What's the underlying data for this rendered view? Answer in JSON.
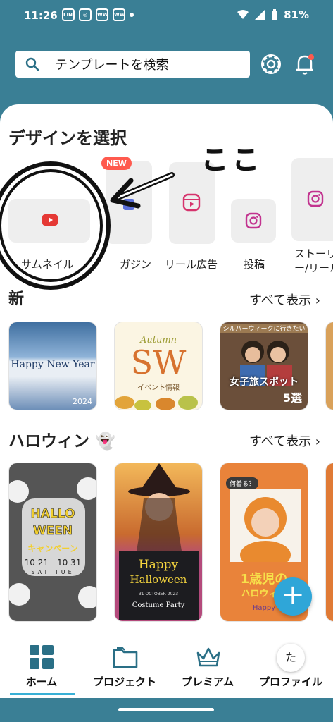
{
  "status_bar": {
    "time": "11:26",
    "battery": "81%",
    "notification_icons": [
      "LINE",
      "instagram",
      "WW",
      "WW"
    ]
  },
  "search": {
    "placeholder": "テンプレートを検索"
  },
  "design_section": {
    "title": "デザインを選択",
    "new_badge": "NEW",
    "items": [
      {
        "label": "サムネイル",
        "icon": "youtube-icon"
      },
      {
        "label": "ガジン",
        "icon": "magazine-icon"
      },
      {
        "label": "リール広告",
        "icon": "reels-icon"
      },
      {
        "label": "投稿",
        "icon": "instagram-icon"
      },
      {
        "label": "ストーリ\nー/リール",
        "icon": "instagram-icon"
      }
    ]
  },
  "annotation": {
    "text": "ここ"
  },
  "new_section": {
    "title": "新",
    "see_all": "すべて表示 ›",
    "thumbs": [
      {
        "title": "Happy New Year",
        "sub": "2024"
      },
      {
        "title": "SW",
        "script": "Autumn",
        "sub": "イベント情報"
      },
      {
        "top": "シルバーウィークに行きたい",
        "title": "女子旅スポット",
        "num": "5選"
      }
    ]
  },
  "halloween_section": {
    "title": "ハロウィン",
    "emoji": "👻",
    "see_all": "すべて表示 ›",
    "thumbs": [
      {
        "line1": "HALLO",
        "line2": "WEEN",
        "line3": "キャンペーン",
        "dates": "10 21 - 10 31",
        "days": "SAT TUE"
      },
      {
        "line1": "Happy",
        "line2": "Halloween",
        "date": "31 OCTOBER 2023",
        "event": "Costume Party"
      },
      {
        "bubble": "何着る？",
        "line1": "1歳児の",
        "line2": "ハロウィン",
        "tag": "Happy"
      }
    ]
  },
  "fab": {
    "label": "+"
  },
  "bottom_nav": [
    {
      "label": "ホーム",
      "icon": "home-grid-icon",
      "active": true
    },
    {
      "label": "プロジェクト",
      "icon": "folder-icon"
    },
    {
      "label": "プレミアム",
      "icon": "crown-icon"
    },
    {
      "label": "プロファイル",
      "icon": "avatar-icon",
      "avatar_text": "た"
    }
  ],
  "colors": {
    "header_bg": "#3a7f95",
    "accent": "#38b0d6",
    "new_badge": "#ff5a4e",
    "fab": "#2fa6d8"
  }
}
